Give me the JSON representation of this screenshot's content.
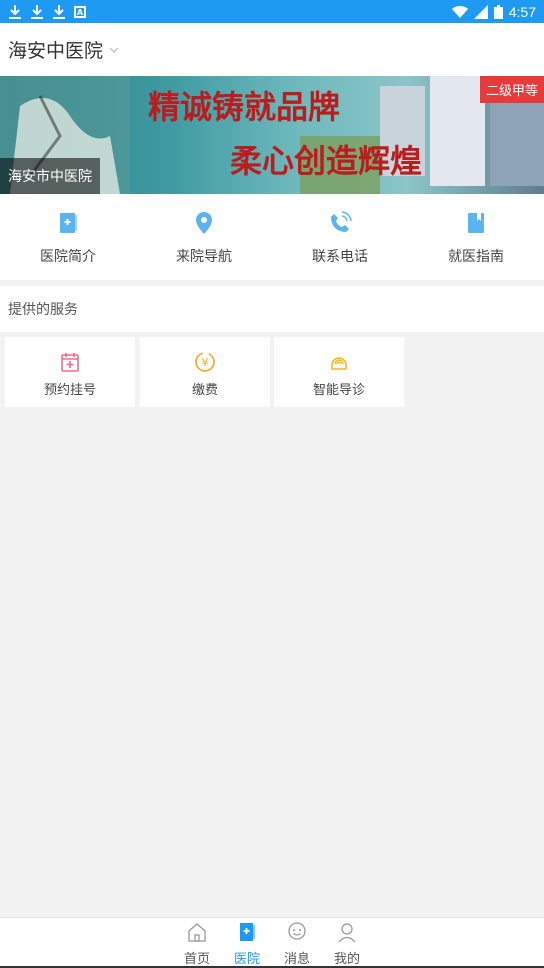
{
  "status_bar": {
    "time": "4:57"
  },
  "header": {
    "title": "海安中医院"
  },
  "banner": {
    "tag": "二级甲等",
    "caption": "海安市中医院",
    "slogan_line1": "精诚铸就品牌",
    "slogan_line2": "柔心创造辉煌"
  },
  "quick_menu": [
    {
      "label": "医院简介",
      "icon": "hospital-doc-icon"
    },
    {
      "label": "来院导航",
      "icon": "location-pin-icon"
    },
    {
      "label": "联系电话",
      "icon": "phone-icon"
    },
    {
      "label": "就医指南",
      "icon": "book-icon"
    }
  ],
  "services": {
    "title": "提供的服务",
    "items": [
      {
        "label": "预约挂号",
        "icon": "calendar-plus-icon"
      },
      {
        "label": "缴费",
        "icon": "yuan-coin-icon"
      },
      {
        "label": "智能导诊",
        "icon": "smart-guide-icon"
      }
    ]
  },
  "bottom_nav": [
    {
      "label": "首页",
      "icon": "home-icon"
    },
    {
      "label": "医院",
      "icon": "hospital-icon",
      "active": true
    },
    {
      "label": "消息",
      "icon": "message-icon"
    },
    {
      "label": "我的",
      "icon": "user-icon"
    }
  ],
  "colors": {
    "primary": "#1e9af3",
    "tag": "#e63b3b"
  }
}
